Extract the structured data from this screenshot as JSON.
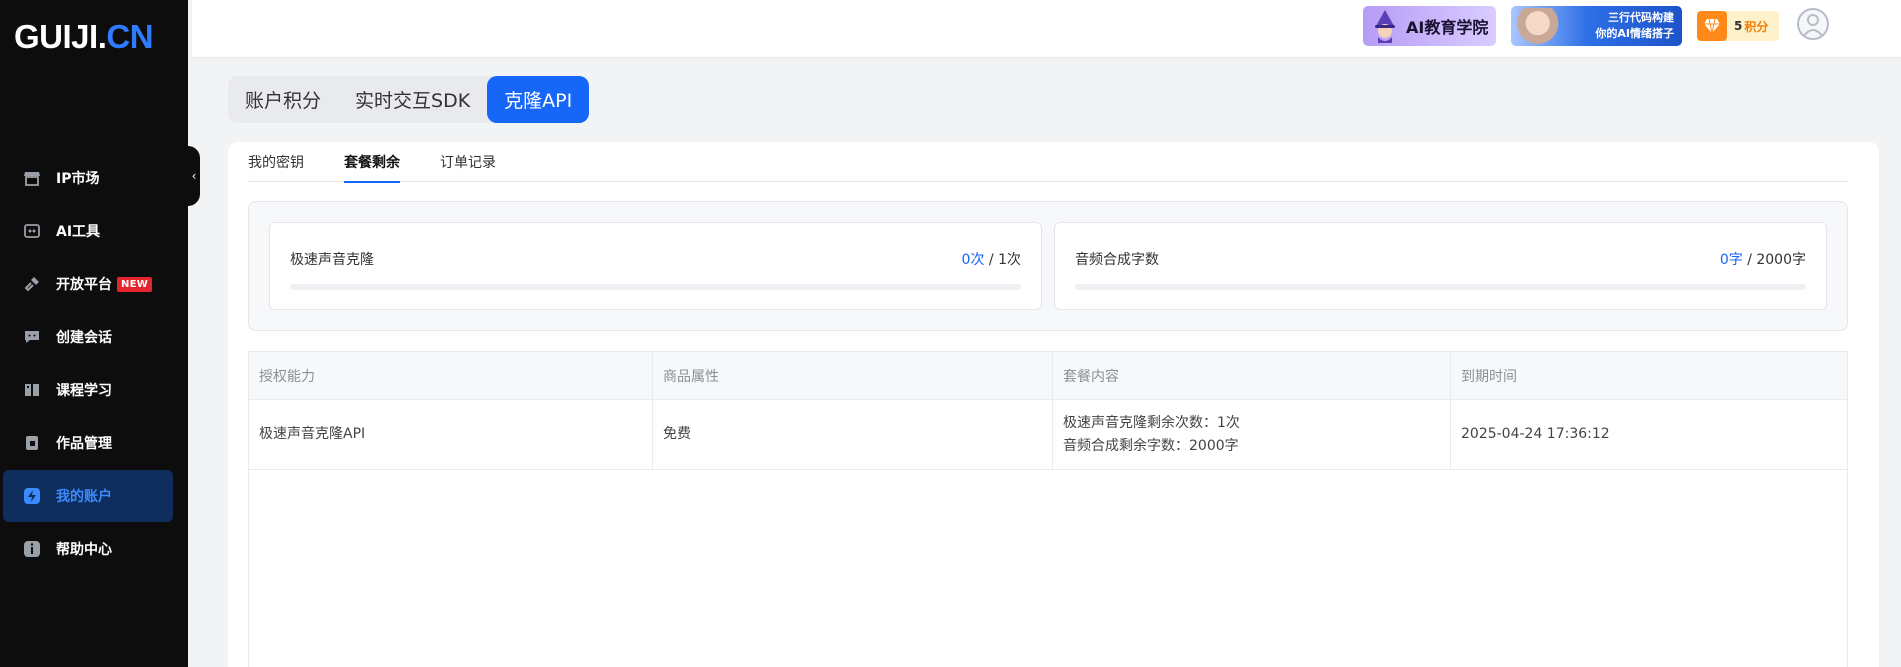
{
  "logo": {
    "main": "GUIJI.",
    "accent": "CN"
  },
  "sidebar": {
    "items": [
      {
        "label": "IP市场",
        "icon": "store-icon"
      },
      {
        "label": "AI工具",
        "icon": "robot-icon"
      },
      {
        "label": "开放平台",
        "icon": "plug-icon",
        "badge": "NEW"
      },
      {
        "label": "创建会话",
        "icon": "chat-icon"
      },
      {
        "label": "课程学习",
        "icon": "book-icon"
      },
      {
        "label": "作品管理",
        "icon": "file-icon"
      },
      {
        "label": "我的账户",
        "icon": "lightning-icon",
        "active": true
      },
      {
        "label": "帮助中心",
        "icon": "info-icon"
      }
    ]
  },
  "header": {
    "banner1": "AI教育学院",
    "banner2_line1": "三行代码构建",
    "banner2_line2": "你的AI情绪搭子",
    "points_value": "5",
    "points_label": "积分"
  },
  "main_tabs": [
    {
      "label": "账户积分",
      "active": false
    },
    {
      "label": "实时交互SDK",
      "active": false
    },
    {
      "label": "克隆API",
      "active": true
    }
  ],
  "sub_tabs": [
    {
      "label": "我的密钥",
      "active": false
    },
    {
      "label": "套餐剩余",
      "active": true
    },
    {
      "label": "订单记录",
      "active": false
    }
  ],
  "quotas": [
    {
      "name": "极速声音克隆",
      "used": "0次",
      "total": " / 1次",
      "fraction": 0
    },
    {
      "name": "音频合成字数",
      "used": "0字",
      "total": " / 2000字",
      "fraction": 0
    }
  ],
  "table": {
    "headers": [
      "授权能力",
      "商品属性",
      "套餐内容",
      "到期时间"
    ],
    "rows": [
      {
        "capability": "极速声音克隆API",
        "attribute": "免费",
        "content_line1": "极速声音克隆剩余次数：1次",
        "content_line2": "音频合成剩余字数：2000字",
        "expiry": "2025-04-24 17:36:12"
      }
    ]
  },
  "colors": {
    "accent": "#1666f7",
    "sidebar_bg": "#0d0d0d",
    "active_nav_bg": "#0f2d5c",
    "badge": "#e3262e"
  }
}
